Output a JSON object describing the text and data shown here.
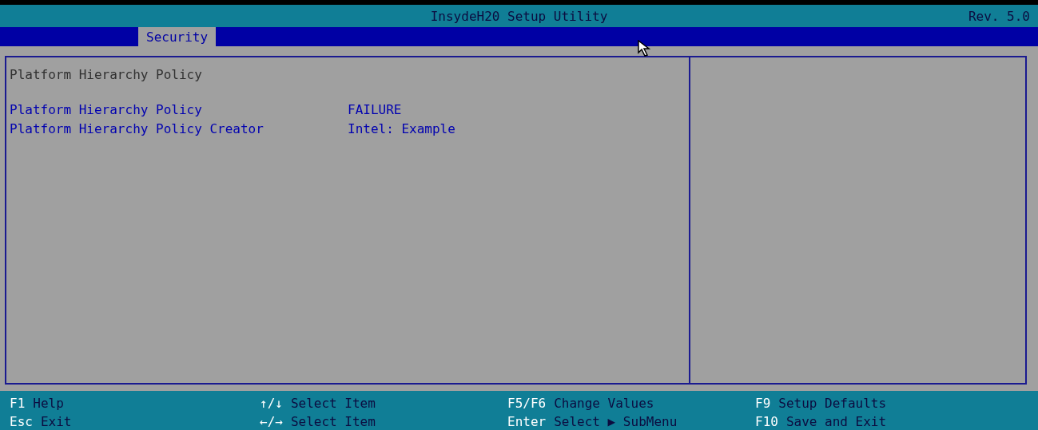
{
  "window": {
    "title": "InsydeH20 Setup Utility",
    "revision": "Rev. 5.0"
  },
  "tabs": [
    {
      "label": "Security",
      "selected": true
    }
  ],
  "main": {
    "heading": "Platform Hierarchy Policy",
    "settings": [
      {
        "label": "Platform Hierarchy Policy",
        "value": "FAILURE"
      },
      {
        "label": "Platform Hierarchy Policy Creator",
        "value": "Intel: Example"
      }
    ]
  },
  "footer": [
    [
      {
        "key": "F1",
        "action": "Help"
      },
      {
        "key": "Esc",
        "action": "Exit"
      }
    ],
    [
      {
        "key": "↑/↓",
        "action": "Select Item"
      },
      {
        "key": "←/→",
        "action": "Select Item"
      }
    ],
    [
      {
        "key": "F5/F6",
        "action": "Change Values"
      },
      {
        "key": "Enter",
        "action": "Select ▶ SubMenu"
      }
    ],
    [
      {
        "key": "F9",
        "action": "Setup Defaults"
      },
      {
        "key": "F10",
        "action": "Save and Exit"
      }
    ]
  ]
}
